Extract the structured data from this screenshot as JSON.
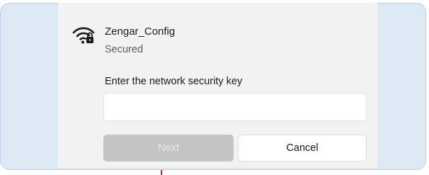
{
  "network": {
    "name": "Zengar_Config",
    "status": "Secured",
    "icon": "wifi-secured-icon"
  },
  "security_key": {
    "label": "Enter the network security key",
    "value": "",
    "placeholder": ""
  },
  "buttons": {
    "next_label": "Next",
    "cancel_label": "Cancel"
  },
  "colors": {
    "panel_background": "#dde9f5",
    "card_background": "#f2f2f2",
    "next_disabled_bg": "#c4c4c4"
  }
}
